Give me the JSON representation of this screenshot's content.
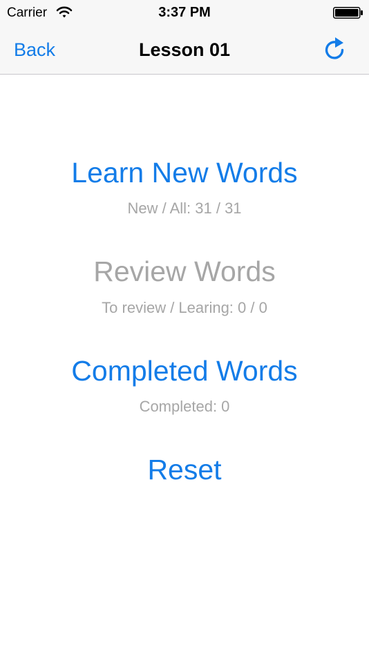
{
  "status_bar": {
    "carrier": "Carrier",
    "time": "3:37 PM",
    "wifi_icon": "wifi-icon",
    "battery_icon": "battery-full-icon"
  },
  "nav_bar": {
    "back_label": "Back",
    "title": "Lesson 01",
    "refresh_icon": "refresh-icon"
  },
  "menu": {
    "learn_new_words": {
      "label": "Learn New Words",
      "stats": "New / All:  31 / 31"
    },
    "review_words": {
      "label": "Review Words",
      "stats": "To review / Learing:  0 / 0"
    },
    "completed_words": {
      "label": "Completed Words",
      "stats": "Completed:  0"
    },
    "reset": {
      "label": "Reset"
    }
  },
  "colors": {
    "accent": "#137ce8",
    "disabled": "#a6a6a6",
    "nav_background": "#f7f7f7"
  }
}
